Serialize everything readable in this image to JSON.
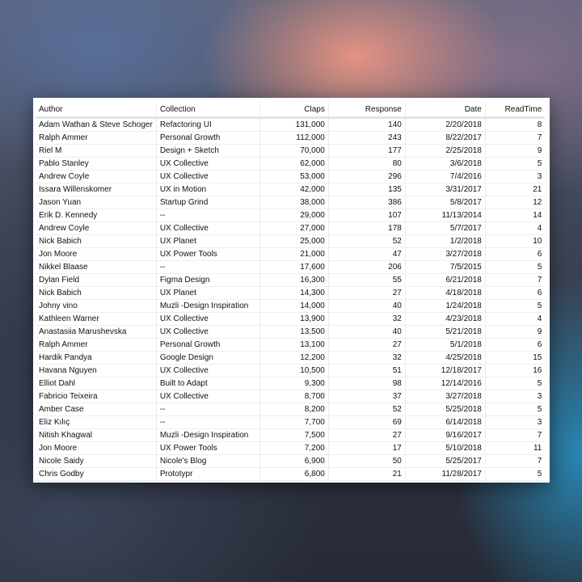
{
  "table": {
    "columns": [
      "Author",
      "Collection",
      "Claps",
      "Response",
      "Date",
      "ReadTime"
    ],
    "rows": [
      [
        "Adam Wathan & Steve Schoger",
        "Refactoring UI",
        "131,000",
        "140",
        "2/20/2018",
        "8"
      ],
      [
        "Ralph Ammer",
        "Personal Growth",
        "112,000",
        "243",
        "8/22/2017",
        "7"
      ],
      [
        "Riel M",
        "Design + Sketch",
        "70,000",
        "177",
        "2/25/2018",
        "9"
      ],
      [
        "Pablo Stanley",
        "UX Collective",
        "62,000",
        "80",
        "3/6/2018",
        "5"
      ],
      [
        "Andrew Coyle",
        "UX Collective",
        "53,000",
        "296",
        "7/4/2016",
        "3"
      ],
      [
        "Issara Willenskomer",
        "UX in Motion",
        "42,000",
        "135",
        "3/31/2017",
        "21"
      ],
      [
        "Jason Yuan",
        "Startup Grind",
        "38,000",
        "386",
        "5/8/2017",
        "12"
      ],
      [
        "Erik D. Kennedy",
        "--",
        "29,000",
        "107",
        "11/13/2014",
        "14"
      ],
      [
        "Andrew Coyle",
        "UX Collective",
        "27,000",
        "178",
        "5/7/2017",
        "4"
      ],
      [
        "Nick Babich",
        "UX Planet",
        "25,000",
        "52",
        "1/2/2018",
        "10"
      ],
      [
        "Jon Moore",
        "UX Power Tools",
        "21,000",
        "47",
        "3/27/2018",
        "6"
      ],
      [
        "Nikkel Blaase",
        "--",
        "17,600",
        "206",
        "7/5/2015",
        "5"
      ],
      [
        "Dylan Field",
        "Figma Design",
        "16,300",
        "55",
        "6/21/2018",
        "7"
      ],
      [
        "Nick Babich",
        "UX Planet",
        "14,300",
        "27",
        "4/18/2018",
        "6"
      ],
      [
        "Johny vino",
        "Muzli -Design Inspiration",
        "14,000",
        "40",
        "1/24/2018",
        "5"
      ],
      [
        "Kathleen Warner",
        "UX Collective",
        "13,900",
        "32",
        "4/23/2018",
        "4"
      ],
      [
        "Anastasiia Marushevska",
        "UX Collective",
        "13,500",
        "40",
        "5/21/2018",
        "9"
      ],
      [
        "Ralph Ammer",
        "Personal Growth",
        "13,100",
        "27",
        "5/1/2018",
        "6"
      ],
      [
        "Hardik Pandya",
        "Google Design",
        "12,200",
        "32",
        "4/25/2018",
        "15"
      ],
      [
        "Havana Nguyen",
        "UX Collective",
        "10,500",
        "51",
        "12/18/2017",
        "16"
      ],
      [
        "Elliot Dahl",
        "Built to Adapt",
        "9,300",
        "98",
        "12/14/2016",
        "5"
      ],
      [
        "Fabricio Teixeira",
        "UX Collective",
        "8,700",
        "37",
        "3/27/2018",
        "3"
      ],
      [
        "Amber Case",
        "--",
        "8,200",
        "52",
        "5/25/2018",
        "5"
      ],
      [
        "Eliz Kılıç",
        "--",
        "7,700",
        "69",
        "6/14/2018",
        "3"
      ],
      [
        "Nitish Khagwal",
        "Muzli -Design Inspiration",
        "7,500",
        "27",
        "9/16/2017",
        "7"
      ],
      [
        "Jon Moore",
        "UX Power Tools",
        "7,200",
        "17",
        "5/10/2018",
        "11"
      ],
      [
        "Nicole Saidy",
        "Nicole's Blog",
        "6,900",
        "50",
        "5/25/2017",
        "7"
      ],
      [
        "Chris Godby",
        "Prototypr",
        "6,800",
        "21",
        "11/28/2017",
        "5"
      ]
    ]
  }
}
